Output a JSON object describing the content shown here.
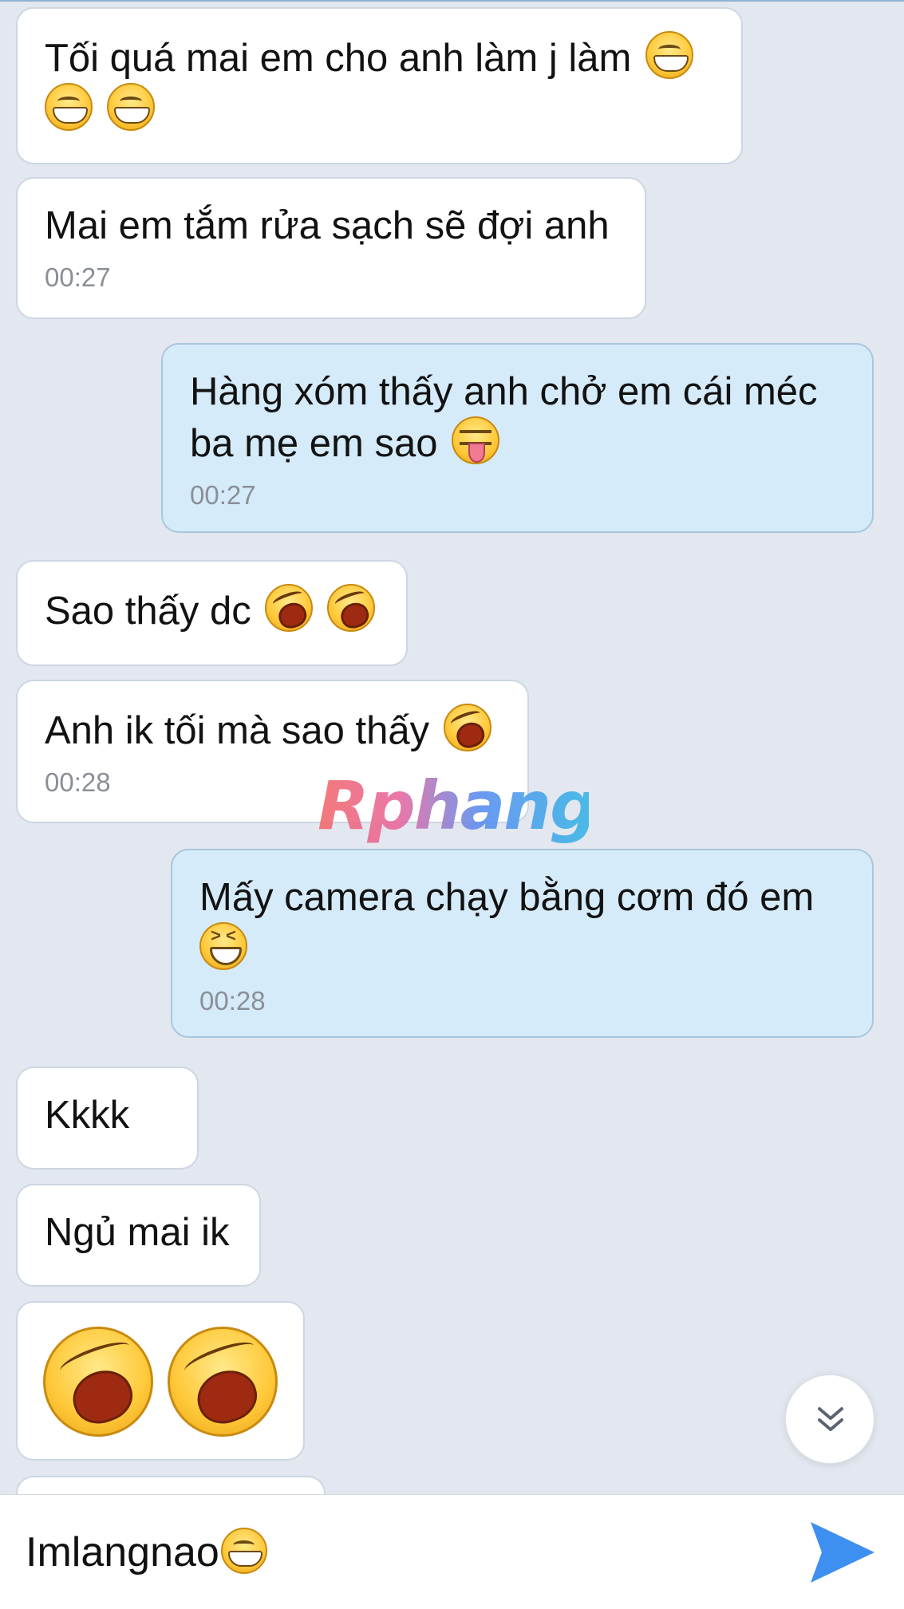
{
  "messages": [
    {
      "side": "in",
      "text": "Tối quá mai em cho anh làm j làm",
      "emoji": [
        "grin",
        "grin",
        "grin"
      ],
      "time": ""
    },
    {
      "side": "in",
      "text": "Mai em tắm rửa sạch sẽ đợi anh",
      "emoji": [],
      "time": "00:27"
    },
    {
      "side": "out",
      "text_line1": "Hàng xóm thấy anh chở em cái méc",
      "text_line2": "ba mẹ em sao",
      "emoji": [
        "tongue"
      ],
      "time": "00:27"
    },
    {
      "side": "in",
      "text": "Sao thấy dc",
      "emoji": [
        "laugh",
        "laugh"
      ],
      "time": ""
    },
    {
      "side": "in",
      "text": "Anh ik tối mà sao thấy",
      "emoji": [
        "laugh"
      ],
      "time": "00:28"
    },
    {
      "side": "out",
      "text": "Mấy camera chạy bằng cơm đó em",
      "emoji": [
        "squint"
      ],
      "time": "00:28"
    },
    {
      "side": "in",
      "text": "Kkkk",
      "emoji": [],
      "time": ""
    },
    {
      "side": "in",
      "text": "Ngủ mai ik",
      "emoji": [],
      "time": ""
    },
    {
      "side": "in",
      "text": "",
      "emoji": [
        "laugh-big",
        "laugh-big"
      ],
      "time": ""
    }
  ],
  "watermark": "Rphang",
  "composer": {
    "value": "Imlangnao",
    "emoji": "grin-icon",
    "send_icon": "send-icon"
  },
  "scroll_button_icon": "double-chevron-down-icon",
  "colors": {
    "background": "#e3e7ef",
    "incoming_bubble": "#ffffff",
    "outgoing_bubble": "#d5ebfa",
    "send_accent": "#3d8ff0"
  }
}
